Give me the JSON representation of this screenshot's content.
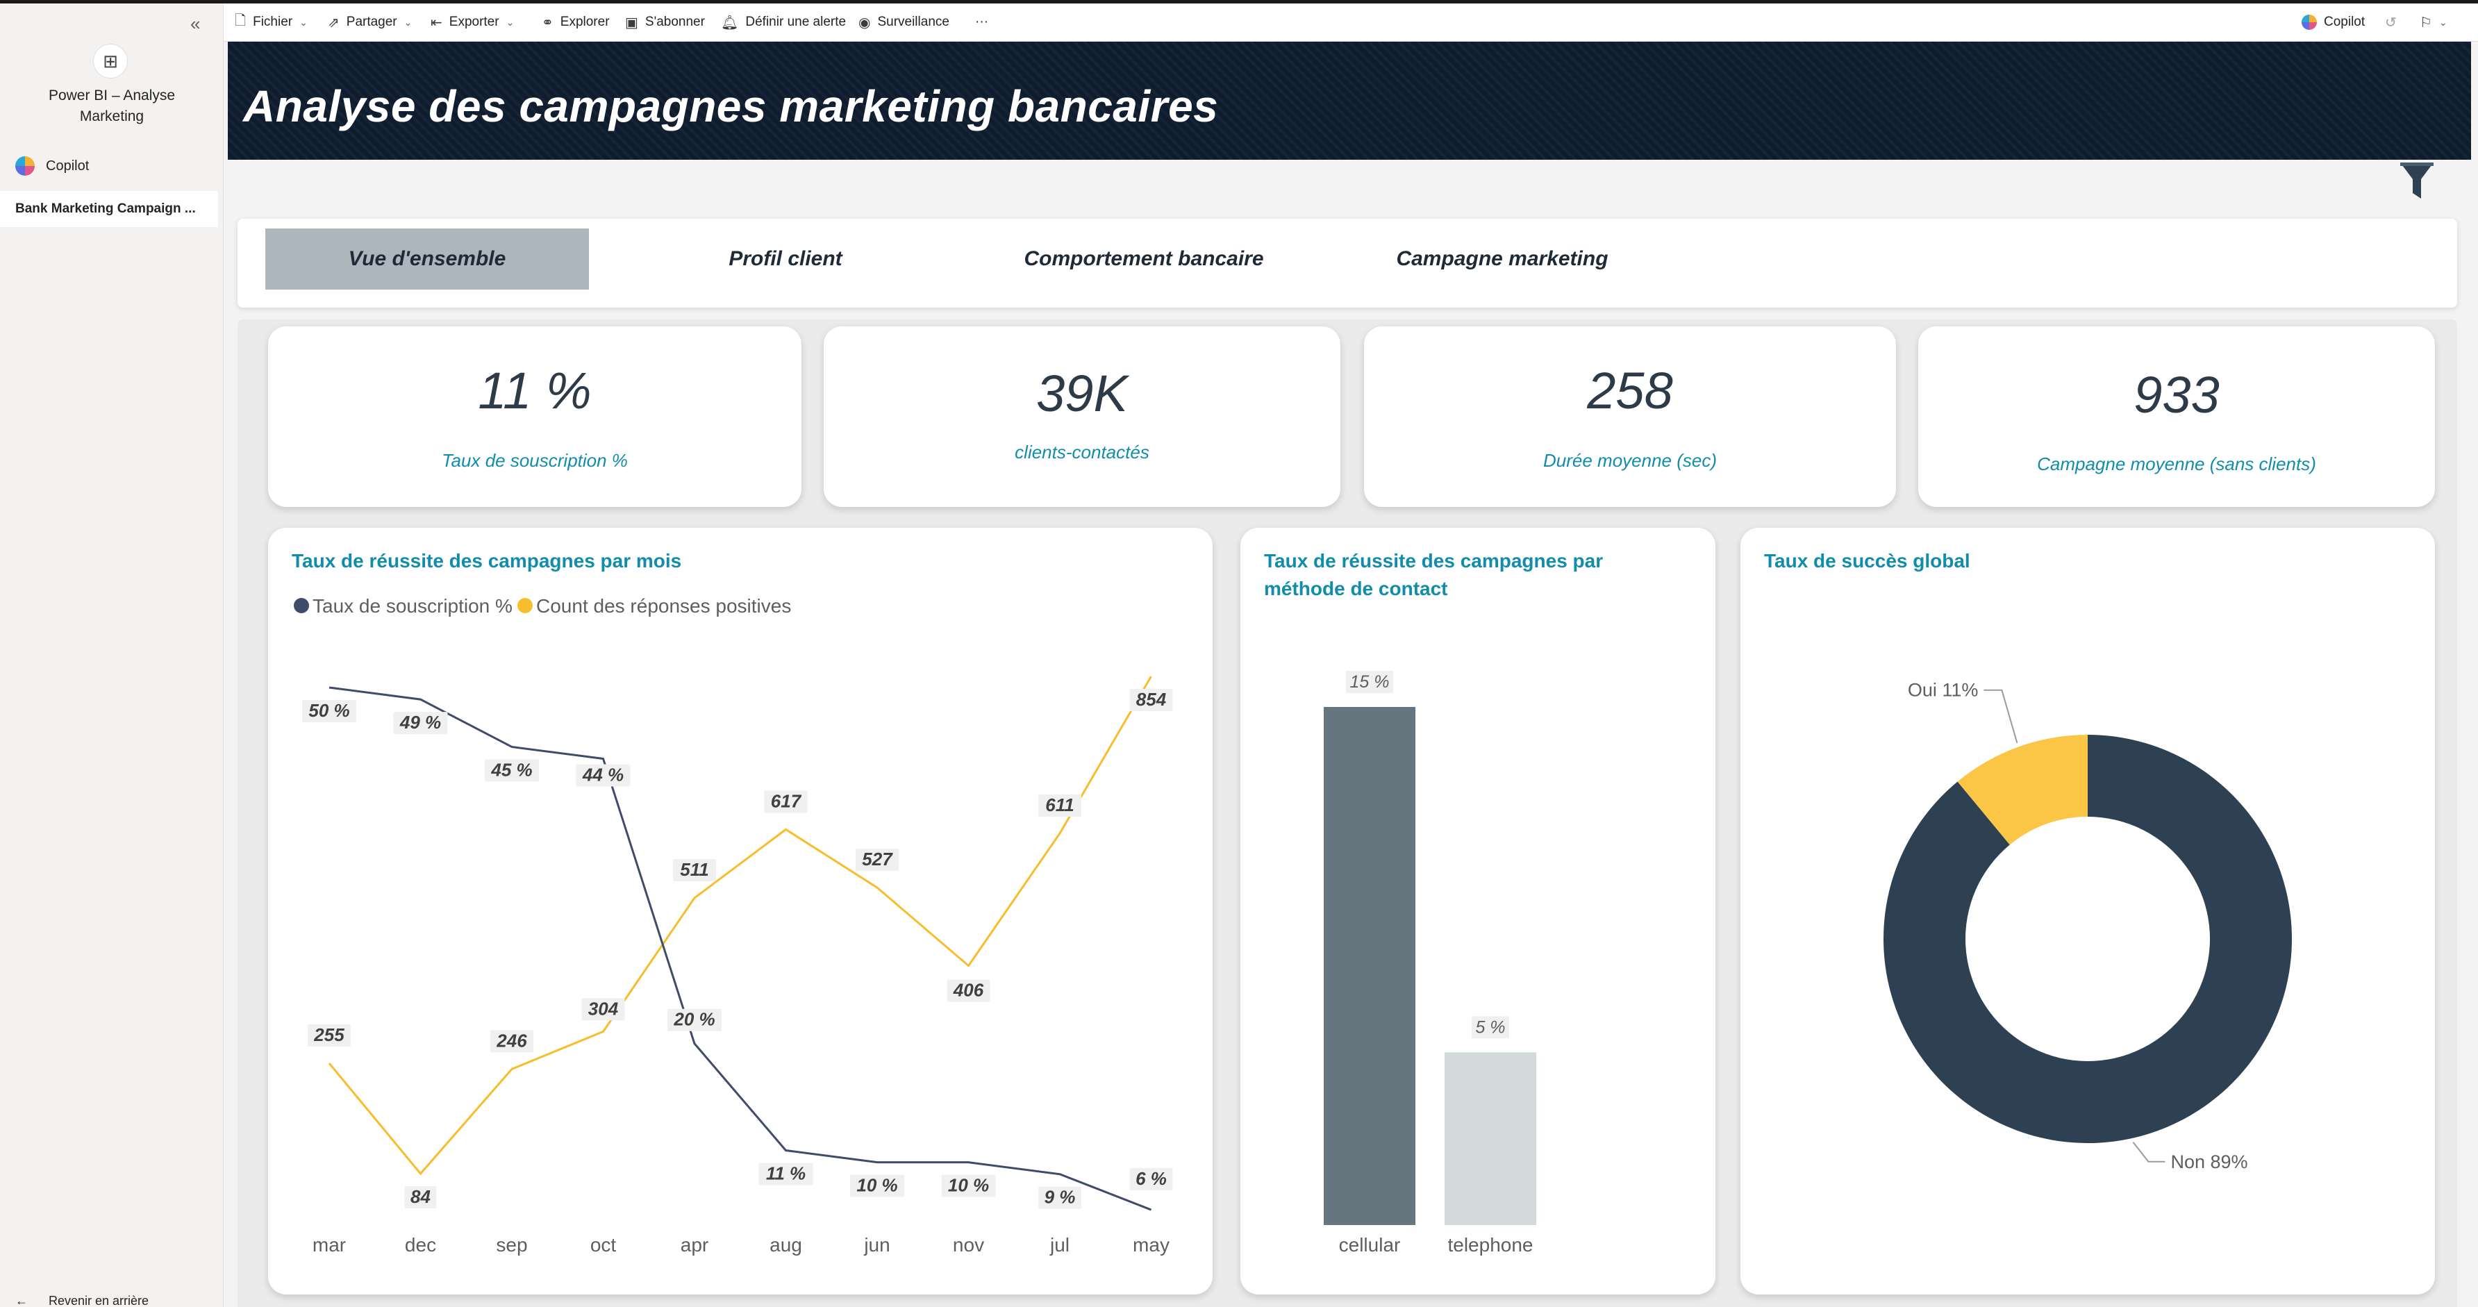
{
  "nav": {
    "app_title": "Power BI – Analyse Marketing",
    "copilot_label": "Copilot",
    "report_item_label": "Bank Marketing Campaign ...",
    "back_label": "Revenir en arrière"
  },
  "toolbar": {
    "file": "Fichier",
    "share": "Partager",
    "export": "Exporter",
    "explore": "Explorer",
    "subscribe": "S'abonner",
    "alert": "Définir une alerte",
    "monitor": "Surveillance",
    "more": "···",
    "copilot": "Copilot"
  },
  "report": {
    "title": "Analyse des campagnes marketing bancaires",
    "tabs": [
      {
        "label": "Vue d'ensemble",
        "active": true
      },
      {
        "label": "Profil client",
        "active": false
      },
      {
        "label": "Comportement bancaire",
        "active": false
      },
      {
        "label": "Campagne marketing",
        "active": false
      }
    ],
    "kpis": [
      {
        "value": "11 %",
        "label": "Taux de souscription %"
      },
      {
        "value": "39K",
        "label": "clients-contactés"
      },
      {
        "value": "258",
        "label": "Durée moyenne (sec)"
      },
      {
        "value": "933",
        "label": "Campagne moyenne (sans clients)"
      }
    ]
  },
  "colors": {
    "accent_teal": "#118dab",
    "navy_series": "#3f4b6b",
    "yellow_series": "#f7bd2c",
    "bar_cellular": "#67757f",
    "bar_telephone": "#d4d9dc",
    "donut_non": "#2e4152",
    "donut_oui": "#fbc646"
  },
  "chart_data": [
    {
      "type": "line",
      "title": "Taux de réussite des campagnes par mois",
      "categories": [
        "mar",
        "dec",
        "sep",
        "oct",
        "apr",
        "aug",
        "jun",
        "nov",
        "jul",
        "may"
      ],
      "series": [
        {
          "name": "Taux de souscription %",
          "values": [
            50,
            49,
            45,
            44,
            20,
            11,
            10,
            10,
            9,
            6
          ],
          "labels": [
            "50 %",
            "49 %",
            "45 %",
            "44 %",
            "20 %",
            "11 %",
            "10 %",
            "10 %",
            "9 %",
            "6 %"
          ]
        },
        {
          "name": "Count des réponses positives",
          "values": [
            255,
            84,
            246,
            304,
            511,
            617,
            527,
            406,
            611,
            854
          ],
          "labels": [
            "255",
            "84",
            "246",
            "304",
            "511",
            "617",
            "527",
            "406",
            "611",
            "854"
          ]
        }
      ],
      "legend_position": "top-left"
    },
    {
      "type": "bar",
      "title": "Taux de réussite des campagnes par méthode de contact",
      "categories": [
        "cellular",
        "telephone"
      ],
      "values": [
        15,
        5
      ],
      "labels": [
        "15 %",
        "5 %"
      ]
    },
    {
      "type": "pie",
      "title": "Taux de succès global",
      "donut": true,
      "slices": [
        {
          "label": "Oui",
          "value": 11,
          "text": "Oui 11%"
        },
        {
          "label": "Non",
          "value": 89,
          "text": "Non 89%"
        }
      ]
    }
  ]
}
